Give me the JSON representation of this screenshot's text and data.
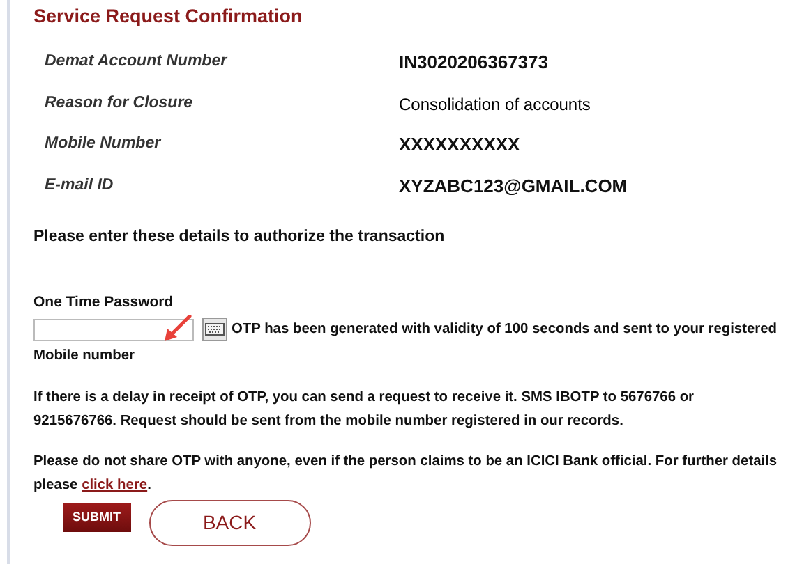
{
  "title": "Service Request Confirmation",
  "details": [
    {
      "label": "Demat Account Number",
      "value": "IN3020206367373"
    },
    {
      "label": "Reason for Closure",
      "value": "Consolidation of accounts"
    },
    {
      "label": "Mobile Number",
      "value": "XXXXXXXXXX"
    },
    {
      "label": "E-mail ID",
      "value": "XYZABC123@GMAIL.COM"
    }
  ],
  "prompt": "Please enter these details to authorize the transaction",
  "otp": {
    "label": "One Time Password",
    "notice": "OTP has been generated with validity of 100 seconds and sent to your registered",
    "notice_continued": "Mobile number"
  },
  "delay_note": "If there is a delay in receipt of OTP, you can send a request to receive it. SMS IBOTP to 5676766 or 9215676766. Request should be sent from the mobile number registered in our records.",
  "warning": {
    "text": "Please do not share OTP with anyone, even if the person claims to be an ICICI Bank official. For further details please ",
    "link": "click here",
    "after": "."
  },
  "buttons": [
    {
      "label": "SUBMIT",
      "kind": "primary"
    },
    {
      "label": "BACK",
      "kind": "outline"
    }
  ]
}
